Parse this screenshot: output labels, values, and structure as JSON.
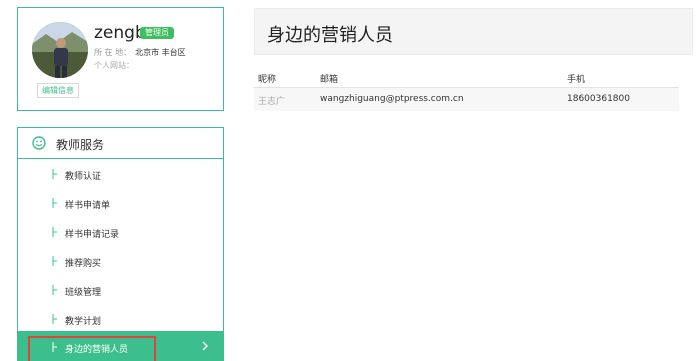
{
  "profile": {
    "username": "zengb",
    "role_badge": "管理员",
    "location_label": "所 在 地：",
    "location_value": "北京市 丰台区",
    "website_label": "个人网站：",
    "edit_button": "编辑信息"
  },
  "service_menu": {
    "title": "教师服务",
    "items": [
      {
        "label": "教师认证"
      },
      {
        "label": "样书申请单"
      },
      {
        "label": "样书申请记录"
      },
      {
        "label": "推荐购买"
      },
      {
        "label": "班级管理"
      },
      {
        "label": "教学计划"
      },
      {
        "label": "身边的营销人员",
        "active": true
      }
    ]
  },
  "main": {
    "page_title": "身边的营销人员",
    "table": {
      "headers": {
        "nickname": "昵称",
        "email": "邮箱",
        "phone": "手机"
      },
      "rows": [
        {
          "nickname": "王志广",
          "email": "wangzhiguang@ptpress.com.cn",
          "phone": "18600361800"
        }
      ]
    }
  },
  "colors": {
    "accent": "#3cbf8d",
    "badge": "#3cbf5c",
    "highlight_outline": "#d9443e"
  }
}
